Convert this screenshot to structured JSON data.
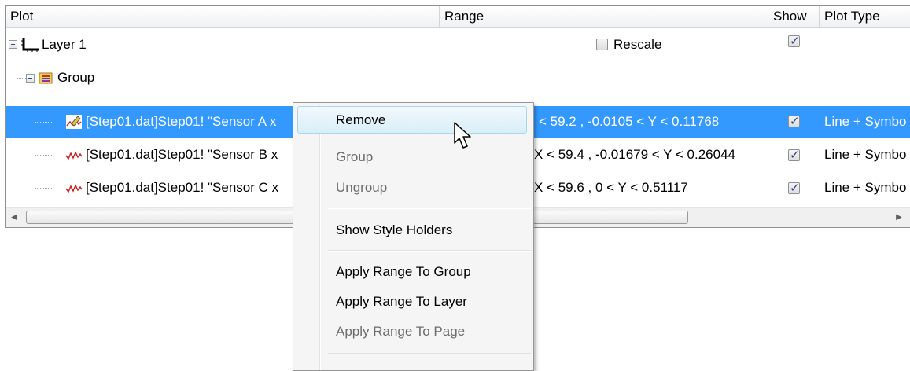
{
  "columns": {
    "plot": "Plot",
    "range": "Range",
    "show": "Show",
    "plot_type": "Plot Type"
  },
  "tree": {
    "layer": {
      "label": "Layer 1",
      "rescale_label": "Rescale",
      "rescale_checked": false,
      "show_checked": true
    },
    "group": {
      "label": "Group"
    },
    "plots": [
      {
        "label": "[Step01.dat]Step01! \"Sensor A x",
        "range": "< 59.2 , -0.0105 < Y < 0.11768",
        "show_checked": true,
        "plot_type": "Line + Symbo",
        "selected": true
      },
      {
        "label": "[Step01.dat]Step01! \"Sensor B x",
        "range": "X < 59.4 , -0.01679 < Y < 0.26044",
        "show_checked": true,
        "plot_type": "Line + Symbo",
        "selected": false
      },
      {
        "label": "[Step01.dat]Step01! \"Sensor C x",
        "range": "X < 59.6 , 0 < Y < 0.51117",
        "show_checked": true,
        "plot_type": "Line + Symbo",
        "selected": false
      }
    ]
  },
  "context_menu": {
    "items": [
      {
        "label": "Remove",
        "enabled": true,
        "hovered": true
      },
      {
        "label": "Group",
        "enabled": false
      },
      {
        "label": "Ungroup",
        "enabled": false
      },
      {
        "label": "Show Style Holders",
        "enabled": true
      },
      {
        "label": "Apply Range To Group",
        "enabled": true
      },
      {
        "label": "Apply Range To Layer",
        "enabled": true
      },
      {
        "label": "Apply Range To Page",
        "enabled": false
      }
    ]
  },
  "colors": {
    "selection": "#3399ff",
    "menu_hover": "#d9eef8",
    "disabled_text": "#6d6d6d"
  },
  "icons": {
    "layer": "layer-axes-icon",
    "group": "group-folder-icon",
    "plot": "line-plot-icon",
    "selected_plot": "edit-plot-icon"
  }
}
